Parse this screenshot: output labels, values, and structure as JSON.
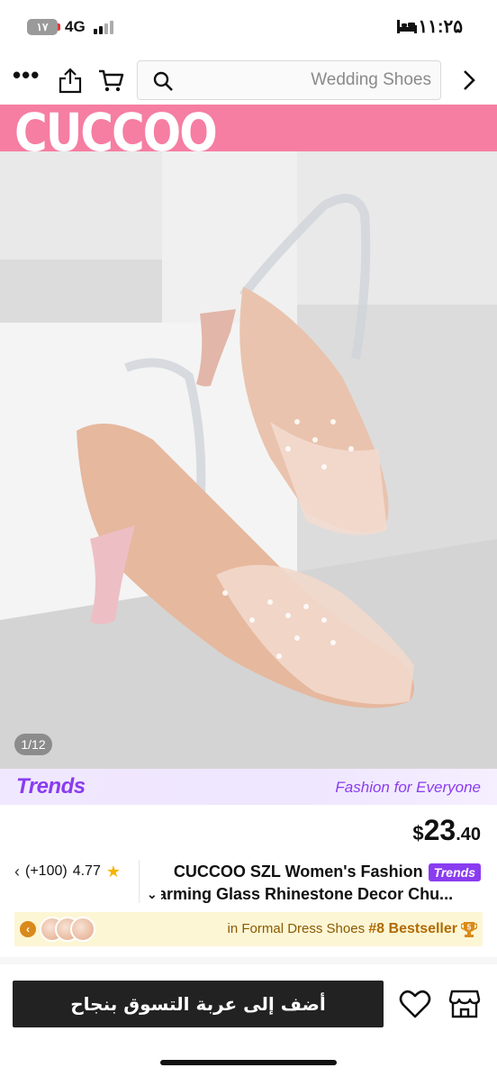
{
  "status_bar": {
    "battery_level": "۱۷",
    "network": "4G",
    "time": "۱۱:۲۵"
  },
  "nav": {
    "search_placeholder": "Wedding Shoes",
    "icons": [
      "more-icon",
      "share-icon",
      "cart-icon",
      "search-icon",
      "forward-icon"
    ]
  },
  "gallery": {
    "brand_logo": "CUCCOO",
    "brand_color": "#f57ea2",
    "image_counter": "1/12"
  },
  "trends": {
    "logo": "Trends",
    "tagline": "Fashion for Everyone",
    "accent_color": "#8a3cf0"
  },
  "product": {
    "price_currency": "$",
    "price_integer": "23",
    "price_decimal": ".40",
    "rating": "4.77",
    "review_count": "(+100)",
    "title_line1": "CUCCOO SZL Women's Fashion",
    "title_badge": "Trends",
    "title_line2": "harming Glass Rhinestone Decor Chu..."
  },
  "bestseller": {
    "category_text": "in Formal Dress Shoes",
    "rank_text": "#8 Bestseller",
    "trophy_number": "5",
    "accent_color": "#fdf6d5"
  },
  "bottom_bar": {
    "add_to_cart_label": "أضف إلى عربة التسوق بنجاح"
  }
}
